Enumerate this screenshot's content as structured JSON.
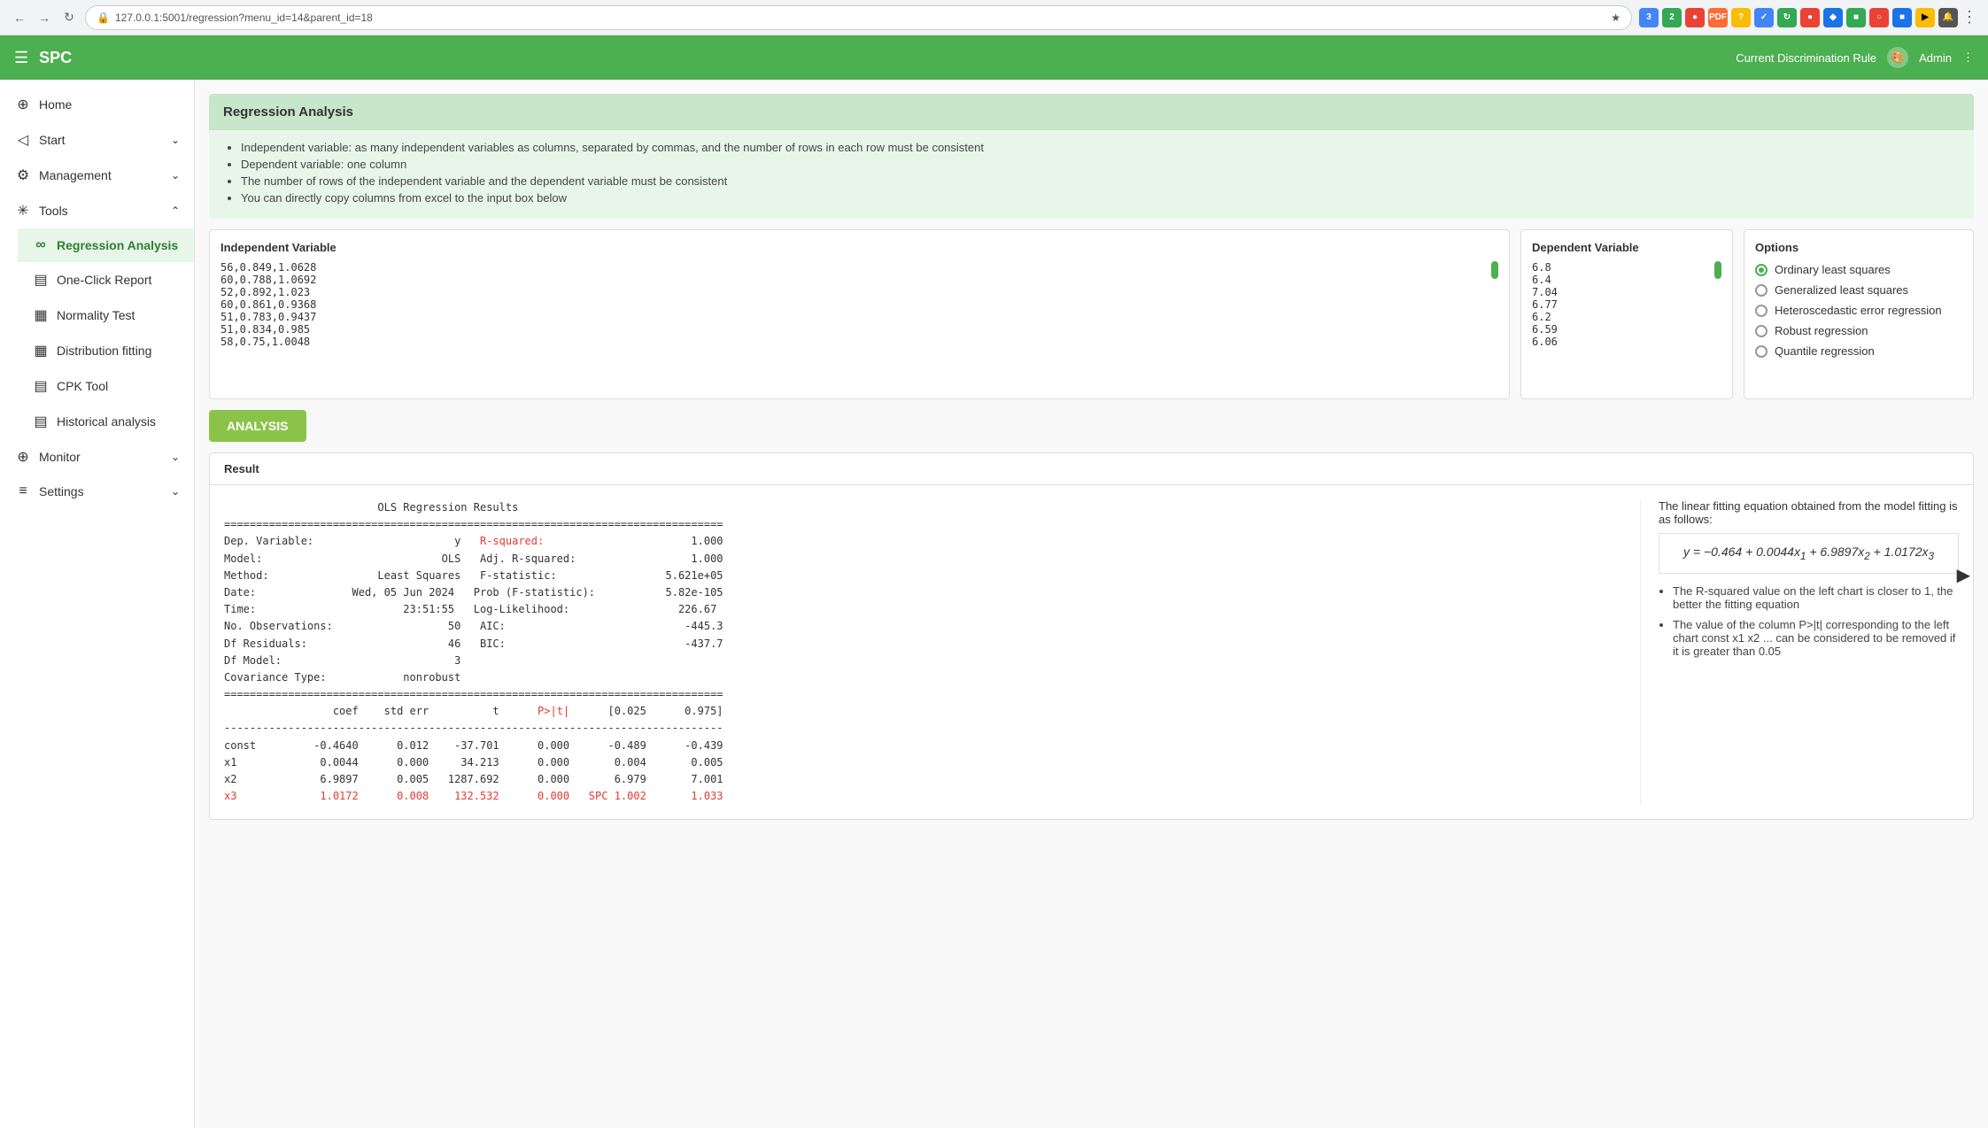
{
  "browser": {
    "url": "127.0.0.1:5001/regression?menu_id=14&parent_id=18",
    "back_btn": "←",
    "forward_btn": "→",
    "reload_btn": "↻"
  },
  "header": {
    "title": "SPC",
    "hamburger": "☰",
    "discrimination_rule": "Current Discrimination Rule",
    "admin": "Admin"
  },
  "sidebar": {
    "items": [
      {
        "id": "home",
        "icon": "⊕",
        "label": "Home",
        "has_arrow": false
      },
      {
        "id": "start",
        "icon": "◁",
        "label": "Start",
        "has_arrow": true
      },
      {
        "id": "management",
        "icon": "⚙",
        "label": "Management",
        "has_arrow": true
      },
      {
        "id": "tools",
        "icon": "✳",
        "label": "Tools",
        "has_arrow": true,
        "expanded": true
      },
      {
        "id": "regression-analysis",
        "icon": "∞",
        "label": "Regression Analysis",
        "active": true,
        "sub": true
      },
      {
        "id": "one-click-report",
        "icon": "▤",
        "label": "One-Click Report",
        "sub": true
      },
      {
        "id": "normality-test",
        "icon": "▦",
        "label": "Normality Test",
        "sub": true
      },
      {
        "id": "distribution-fitting",
        "icon": "▦",
        "label": "Distribution fitting",
        "sub": true
      },
      {
        "id": "cpk-tool",
        "icon": "▤",
        "label": "CPK Tool",
        "sub": true
      },
      {
        "id": "historical-analysis",
        "icon": "▤",
        "label": "Historical analysis",
        "sub": true
      },
      {
        "id": "monitor",
        "icon": "⊕",
        "label": "Monitor",
        "has_arrow": true
      },
      {
        "id": "settings",
        "icon": "≡",
        "label": "Settings",
        "has_arrow": true
      }
    ]
  },
  "main": {
    "section_title": "Regression Analysis",
    "info_items": [
      "Independent variable: as many independent variables as columns, separated by commas, and the number of rows in each row must be consistent",
      "Dependent variable: one column",
      "The number of rows of the independent variable and the dependent variable must be consistent",
      "You can directly copy columns from excel to the input box below"
    ],
    "independent_label": "Independent Variable",
    "independent_data": "56,0.849,1.0628\n60,0.788,1.0692\n52,0.892,1.023\n60,0.861,0.9368\n51,0.783,0.9437\n51,0.834,0.985\n58,0.75,1.0048",
    "dependent_label": "Dependent Variable",
    "dependent_data": "6.8\n6.4\n7.04\n6.77\n6.2\n6.59\n6.06\n...",
    "options_label": "Options",
    "options": [
      {
        "id": "ols",
        "label": "Ordinary least squares",
        "selected": true
      },
      {
        "id": "gls",
        "label": "Generalized least squares",
        "selected": false
      },
      {
        "id": "het",
        "label": "Heteroscedastic error regression",
        "selected": false
      },
      {
        "id": "robust",
        "label": "Robust regression",
        "selected": false
      },
      {
        "id": "quantile",
        "label": "Quantile regression",
        "selected": false
      }
    ],
    "analysis_button": "ANALYSIS",
    "result_tab": "Result",
    "result_title": "OLS Regression Results",
    "result_table": {
      "header_line": "==============================================================================",
      "dep_var_label": "Dep. Variable:",
      "dep_var_value": "y",
      "r_squared_label": "R-squared:",
      "r_squared_value": "1.000",
      "model_label": "Model:",
      "model_value": "OLS",
      "adj_r_squared_label": "Adj. R-squared:",
      "adj_r_squared_value": "1.000",
      "method_label": "Method:",
      "method_value": "Least Squares",
      "f_statistic_label": "F-statistic:",
      "f_statistic_value": "5.621e+05",
      "date_label": "Date:",
      "date_value": "Wed, 05 Jun 2024",
      "prob_f_label": "Prob (F-statistic):",
      "prob_f_value": "5.82e-105",
      "time_label": "Time:",
      "time_value": "23:51:55",
      "log_likelihood_label": "Log-Likelihood:",
      "log_likelihood_value": "226.67",
      "no_obs_label": "No. Observations:",
      "no_obs_value": "50",
      "aic_label": "AIC:",
      "aic_value": "-445.3",
      "df_residuals_label": "Df Residuals:",
      "df_residuals_value": "46",
      "bic_label": "BIC:",
      "bic_value": "-437.7",
      "df_model_label": "Df Model:",
      "df_model_value": "3",
      "cov_type_label": "Covariance Type:",
      "cov_type_value": "nonrobust",
      "col_header": "                 coef    std err          t      P>|t|      [0.025      0.975]",
      "sep_line": "------------------------------------------------------------------------------",
      "rows": [
        {
          "name": "const",
          "coef": "-0.4640",
          "std_err": "0.012",
          "t": "-37.701",
          "p": "0.000",
          "low": "-0.489",
          "high": "-0.439"
        },
        {
          "name": "x1",
          "coef": "0.0044",
          "std_err": "0.000",
          "t": "34.213",
          "p": "0.000",
          "low": "0.004",
          "high": "0.005"
        },
        {
          "name": "x2",
          "coef": "6.9897",
          "std_err": "0.005",
          "t": "1287.692",
          "p": "0.000",
          "low": "6.979",
          "high": "7.001"
        },
        {
          "name": "x3",
          "coef": "1.0172",
          "std_err": "0.008",
          "t": "132.532",
          "p": "0.000",
          "low": "SPC 1.002",
          "high": "1.033"
        }
      ]
    },
    "equation_text": "The linear fitting equation obtained from the model fitting is as follows:",
    "equation": "y = −0.464 + 0.0044x₁ + 6.9897x₂ + 1.0172x₃",
    "notes": [
      "The R-squared value on the left chart is closer to 1, the better the fitting equation",
      "The value of the column P>|t| corresponding to the left chart const x1 x2 ... can be considered to be removed if it is greater than 0.05"
    ]
  }
}
